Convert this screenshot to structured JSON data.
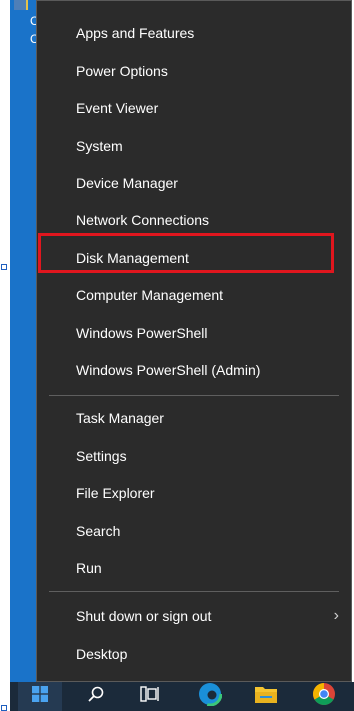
{
  "desktop": {
    "letters": [
      "C",
      "C"
    ]
  },
  "context_menu": {
    "groups": [
      [
        {
          "label": "Apps and Features"
        },
        {
          "label": "Power Options"
        },
        {
          "label": "Event Viewer"
        },
        {
          "label": "System"
        },
        {
          "label": "Device Manager"
        },
        {
          "label": "Network Connections"
        },
        {
          "label": "Disk Management",
          "highlighted": true
        },
        {
          "label": "Computer Management"
        },
        {
          "label": "Windows PowerShell"
        },
        {
          "label": "Windows PowerShell (Admin)"
        }
      ],
      [
        {
          "label": "Task Manager"
        },
        {
          "label": "Settings"
        },
        {
          "label": "File Explorer"
        },
        {
          "label": "Search"
        },
        {
          "label": "Run"
        }
      ],
      [
        {
          "label": "Shut down or sign out",
          "submenu_arrow": "›"
        },
        {
          "label": "Desktop"
        }
      ]
    ]
  },
  "taskbar": {
    "items": [
      {
        "icon": "windows-start-icon"
      },
      {
        "icon": "search-icon"
      },
      {
        "icon": "task-view-icon"
      },
      {
        "icon": "edge-icon"
      },
      {
        "icon": "file-explorer-icon"
      },
      {
        "icon": "chrome-icon"
      }
    ]
  },
  "colors": {
    "menu_bg": "#2b2b2b",
    "highlight_border": "#e0161e",
    "taskbar_bg": "#1b2a3a",
    "desktop_bg": "#1a73c9"
  }
}
